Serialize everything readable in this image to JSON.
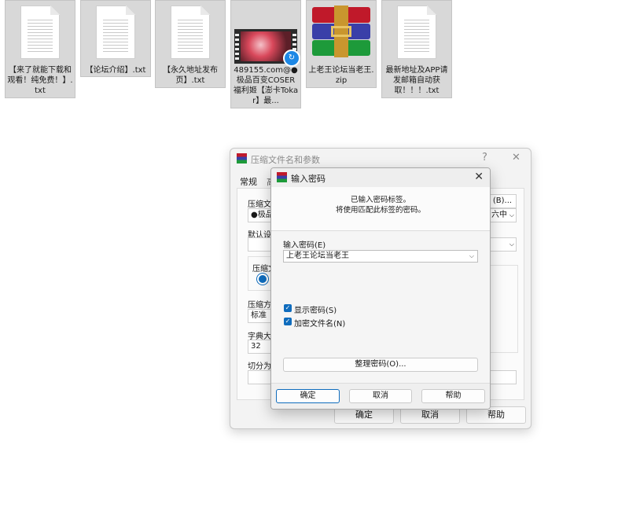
{
  "desktop": {
    "files": [
      {
        "name": "【来了就能下载和观看！纯免费！】.txt",
        "type": "txt"
      },
      {
        "name": "【论坛介绍】.txt",
        "type": "txt"
      },
      {
        "name": "【永久地址发布页】.txt",
        "type": "txt"
      },
      {
        "name": "489155.com@●极品百变COSER福利姬【澎卡Tokar】最...",
        "type": "video"
      },
      {
        "name": "上老王论坛当老王.zip",
        "type": "zip"
      },
      {
        "name": "最新地址及APP请发邮箱自动获取！！！.txt",
        "type": "txt"
      }
    ]
  },
  "back_dialog": {
    "title": "压缩文件名和参数",
    "help_glyph": "?",
    "close_glyph": "✕",
    "tabs": [
      "常规",
      "高"
    ],
    "archive_name_label": "压缩文(",
    "archive_name_value": "●极品",
    "browse_label": "(B)...",
    "update_mode_value": "六中",
    "profile_label": "默认设",
    "format_label": "压缩文",
    "method_label": "压缩方",
    "method_value": "标准",
    "dict_label": "字典大",
    "dict_value": "32",
    "split_label": "切分为",
    "ok": "确定",
    "cancel": "取消",
    "help": "帮助"
  },
  "password_dialog": {
    "title": "输入密码",
    "close_glyph": "✕",
    "info_line1": "已输入密码标签。",
    "info_line2": "将使用匹配此标签的密码。",
    "password_label": "输入密码(E)",
    "password_value": "上老王论坛当老王",
    "show_password": "显示密码(S)",
    "encrypt_names": "加密文件名(N)",
    "organize_button": "整理密码(O)...",
    "ok": "确定",
    "cancel": "取消",
    "help": "帮助"
  }
}
